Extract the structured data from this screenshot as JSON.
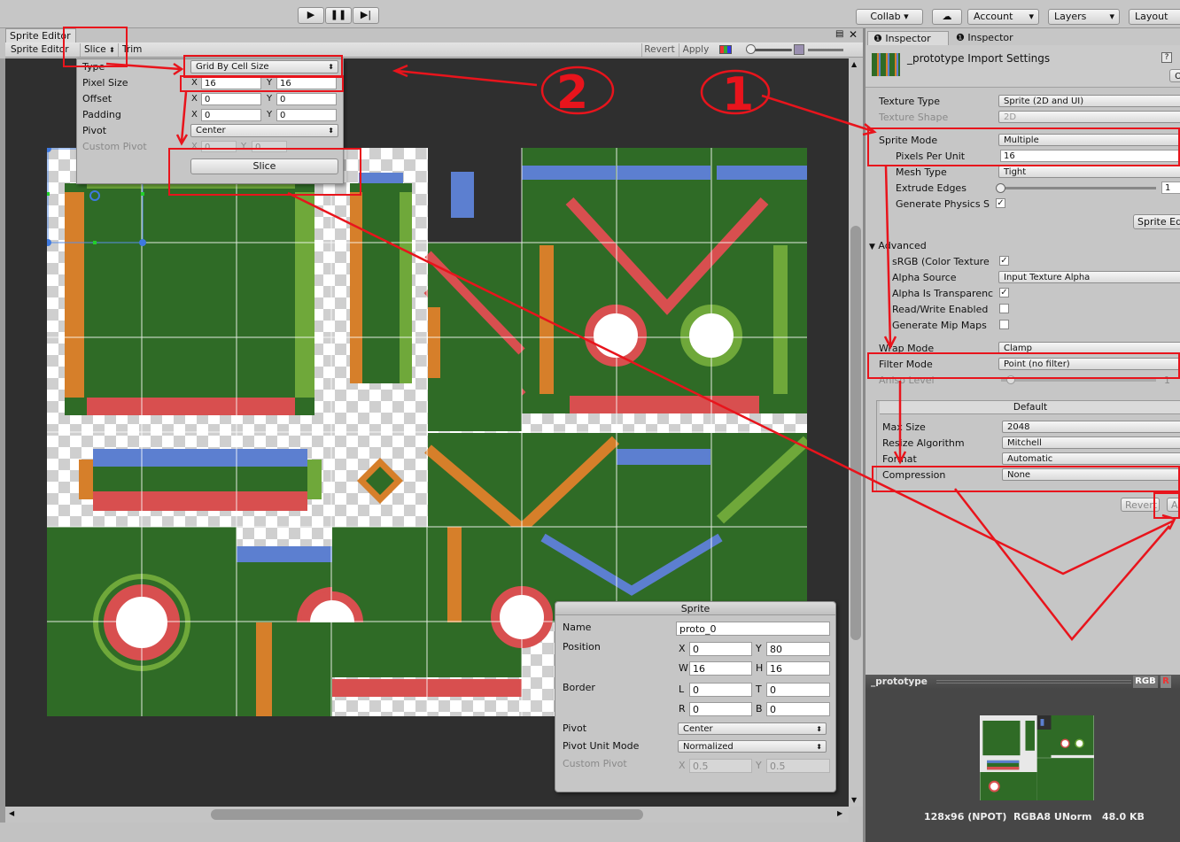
{
  "toolbar": {
    "play_icon": "play-icon",
    "pause_icon": "pause-icon",
    "step_icon": "step-icon",
    "collab_label": "Collab ▾",
    "cloud_icon": "cloud-icon",
    "account_label": "Account",
    "layers_label": "Layers",
    "layout_label": "Layout"
  },
  "sprite_editor": {
    "window_title": "Sprite Editor",
    "mode_label": "Sprite Editor",
    "slice_label": "Slice",
    "trim_label": "Trim",
    "revert_label": "Revert",
    "apply_label": "Apply"
  },
  "slice_popup": {
    "type_label": "Type",
    "type_value": "Grid By Cell Size",
    "pixel_size_label": "Pixel Size",
    "pixel_x": "16",
    "pixel_y": "16",
    "offset_label": "Offset",
    "offset_x": "0",
    "offset_y": "0",
    "padding_label": "Padding",
    "padding_x": "0",
    "padding_y": "0",
    "pivot_label": "Pivot",
    "pivot_value": "Center",
    "custom_pivot_label": "Custom Pivot",
    "custom_x": "0",
    "custom_y": "0",
    "slice_button": "Slice",
    "x": "X",
    "y": "Y"
  },
  "sprite_panel": {
    "title": "Sprite",
    "name_label": "Name",
    "name_value": "proto_0",
    "position_label": "Position",
    "pos_x": "0",
    "pos_y": "80",
    "pos_w": "16",
    "pos_h": "16",
    "border_label": "Border",
    "border_l": "0",
    "border_t": "0",
    "border_r": "0",
    "border_b": "0",
    "pivot_label": "Pivot",
    "pivot_value": "Center",
    "pivot_unit_label": "Pivot Unit Mode",
    "pivot_unit_value": "Normalized",
    "custom_pivot_label": "Custom Pivot",
    "custom_x": "0.5",
    "custom_y": "0.5",
    "x": "X",
    "y": "Y",
    "w": "W",
    "h": "H",
    "l": "L",
    "t": "T",
    "r": "R",
    "b": "B"
  },
  "inspector": {
    "tab1": "Inspector",
    "tab2": "Inspector",
    "title": "_prototype Import Settings",
    "texture_type_label": "Texture Type",
    "texture_type_value": "Sprite (2D and UI)",
    "texture_shape_label": "Texture Shape",
    "texture_shape_value": "2D",
    "sprite_mode_label": "Sprite Mode",
    "sprite_mode_value": "Multiple",
    "ppu_label": "Pixels Per Unit",
    "ppu_value": "16",
    "mesh_type_label": "Mesh Type",
    "mesh_type_value": "Tight",
    "extrude_label": "Extrude Edges",
    "extrude_value": "1",
    "gen_physics_label": "Generate Physics S",
    "sprite_editor_button": "Sprite Ed",
    "advanced_label": "Advanced",
    "srgb_label": "sRGB (Color Texture",
    "alpha_source_label": "Alpha Source",
    "alpha_source_value": "Input Texture Alpha",
    "alpha_transp_label": "Alpha Is Transparenc",
    "readwrite_label": "Read/Write Enabled",
    "mipmaps_label": "Generate Mip Maps",
    "wrap_label": "Wrap Mode",
    "wrap_value": "Clamp",
    "filter_label": "Filter Mode",
    "filter_value": "Point (no filter)",
    "aniso_label": "Aniso Level",
    "aniso_value": "1",
    "platform_tab": "Default",
    "max_size_label": "Max Size",
    "max_size_value": "2048",
    "resize_label": "Resize Algorithm",
    "resize_value": "Mitchell",
    "format_label": "Format",
    "format_value": "Automatic",
    "compression_label": "Compression",
    "compression_value": "None",
    "revert_label": "Revert",
    "apply_label": "A",
    "check": "✓"
  },
  "preview": {
    "name": "_prototype",
    "rgb_label": "RGB",
    "r_label": "R",
    "info": "128x96 (NPOT)  RGBA8 UNorm   48.0 KB"
  },
  "annotations": {
    "step_one": "1",
    "step_two": "2"
  },
  "colors": {
    "green": "#2f6b26",
    "orange": "#d67f2a",
    "red": "#d84f4f",
    "blue": "#5c7fd0",
    "lime": "#6fa83a",
    "annotation_red": "#e8141c"
  }
}
